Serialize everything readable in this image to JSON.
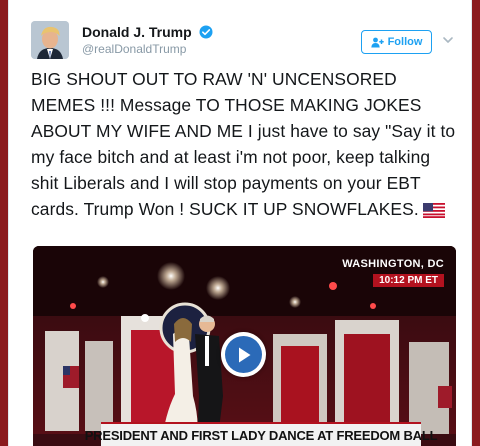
{
  "tweet": {
    "display_name": "Donald J. Trump",
    "handle": "@realDonaldTrump",
    "follow_label": "Follow",
    "text": "BIG SHOUT OUT TO RAW 'N' UNCENSORED MEMES !!! Message TO THOSE MAKING JOKES ABOUT MY WIFE AND ME I just have to say \"Say it to my face bitch and at least i'm not poor, keep talking shit Liberals and I will stop payments on your EBT cards. Trump Won ! SUCK IT UP SNOWFLAKES.",
    "emoji": "us-flag-icon"
  },
  "media": {
    "location": "WASHINGTON, DC",
    "time": "10:12",
    "time_suffix": "PM ET",
    "headline": "PRESIDENT AND FIRST LADY DANCE AT FREEDOM BALL"
  },
  "colors": {
    "accent": "#1da1f2",
    "verified": "#1da1f2",
    "text": "#14171a",
    "secondary_text": "#8899a6",
    "news_red": "#b3121f",
    "play_blue": "#2b6ab8",
    "page_background": "#8a1a1e"
  }
}
